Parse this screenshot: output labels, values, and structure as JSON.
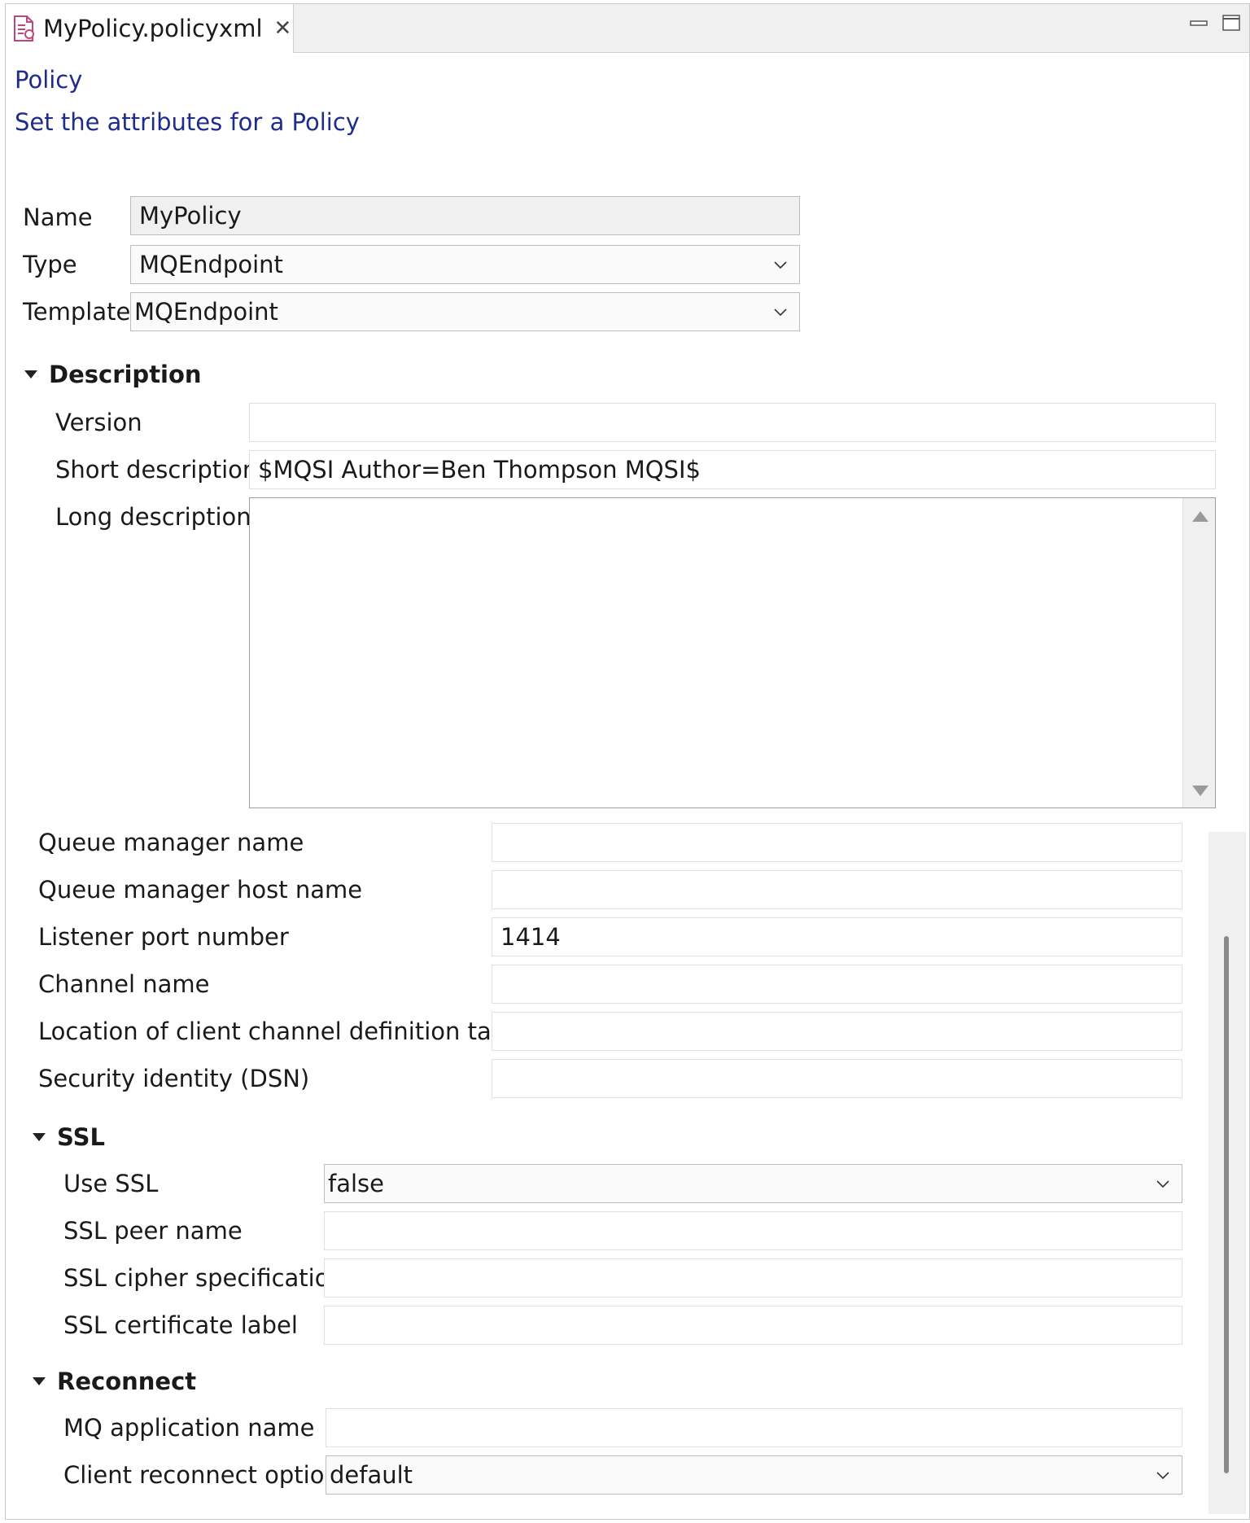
{
  "tab": {
    "title": "MyPolicy.policyxml",
    "close_icon": "close-icon"
  },
  "header": {
    "title": "Policy",
    "subtitle": "Set the attributes for a Policy"
  },
  "general": {
    "name_label": "Name",
    "name_value": "MyPolicy",
    "type_label": "Type",
    "type_value": "MQEndpoint",
    "template_label": "Template",
    "template_value": "MQEndpoint"
  },
  "description": {
    "heading": "Description",
    "version_label": "Version",
    "version_value": "",
    "short_label": "Short description",
    "short_value": "$MQSI Author=Ben Thompson MQSI$",
    "long_label": "Long description",
    "long_value": ""
  },
  "connection": {
    "qm_name_label": "Queue manager name",
    "qm_name_value": "",
    "qm_host_label": "Queue manager host name",
    "qm_host_value": "",
    "port_label": "Listener port number",
    "port_value": "1414",
    "channel_label": "Channel name",
    "channel_value": "",
    "ccdt_label": "Location of client channel definition table",
    "ccdt_value": "",
    "security_label": "Security identity (DSN)",
    "security_value": ""
  },
  "ssl": {
    "heading": "SSL",
    "use_ssl_label": "Use SSL",
    "use_ssl_value": "false",
    "peer_label": "SSL peer name",
    "peer_value": "",
    "cipher_label": "SSL cipher specification",
    "cipher_value": "",
    "cert_label": "SSL certificate label",
    "cert_value": ""
  },
  "reconnect": {
    "heading": "Reconnect",
    "app_label": "MQ application name",
    "app_value": "",
    "option_label": "Client reconnect option",
    "option_value": "default"
  }
}
